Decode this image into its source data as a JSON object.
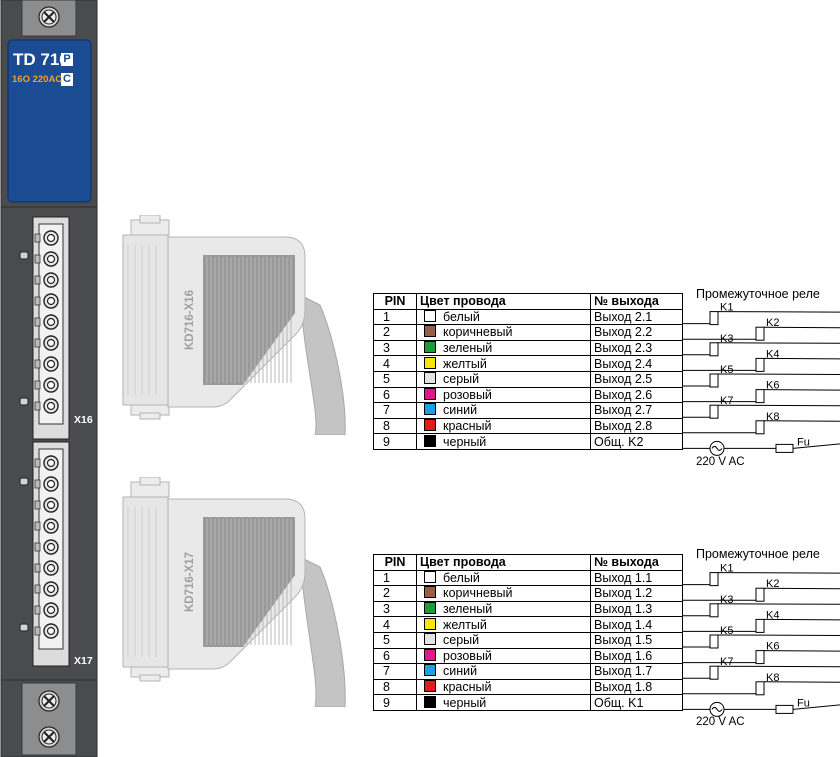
{
  "module": {
    "model": "TD 716",
    "badge_top": "P",
    "spec": "16O 220AC",
    "badge_bottom": "C",
    "connector_top_label": "X16",
    "connector_bottom_label": "X17"
  },
  "cables": [
    {
      "label": "KD716-X16"
    },
    {
      "label": "KD716-X17"
    }
  ],
  "colors": {
    "panel": "#4a4b4d",
    "label_plate": "#1b4c93",
    "spec_text": "#f0a030",
    "wire_colors": [
      "#ffffff",
      "#9a5d46",
      "#1f9a3a",
      "#f7e600",
      "#e4e4e4",
      "#e0188c",
      "#1ea0e0",
      "#e41b1b",
      "#000000"
    ]
  },
  "tables": [
    {
      "headers": [
        "PIN",
        "Цвет провода",
        "№ выхода"
      ],
      "relay_title": "Промежуточное реле",
      "ac_label": "220 V AC",
      "fuse_label": "Fu",
      "rows": [
        {
          "pin": "1",
          "color": "белый",
          "output": "Выход 2.1",
          "relay": "K1"
        },
        {
          "pin": "2",
          "color": "коричневый",
          "output": "Выход 2.2",
          "relay": "K2"
        },
        {
          "pin": "3",
          "color": "зеленый",
          "output": "Выход 2.3",
          "relay": "K3"
        },
        {
          "pin": "4",
          "color": "желтый",
          "output": "Выход 2.4",
          "relay": "K4"
        },
        {
          "pin": "5",
          "color": "серый",
          "output": "Выход 2.5",
          "relay": "K5"
        },
        {
          "pin": "6",
          "color": "розовый",
          "output": "Выход 2.6",
          "relay": "K6"
        },
        {
          "pin": "7",
          "color": "синий",
          "output": "Выход 2.7",
          "relay": "K7"
        },
        {
          "pin": "8",
          "color": "красный",
          "output": "Выход 2.8",
          "relay": "K8"
        },
        {
          "pin": "9",
          "color": "черный",
          "output": "Общ. K2",
          "relay": ""
        }
      ]
    },
    {
      "headers": [
        "PIN",
        "Цвет провода",
        "№ выхода"
      ],
      "relay_title": "Промежуточное реле",
      "ac_label": "220 V AC",
      "fuse_label": "Fu",
      "rows": [
        {
          "pin": "1",
          "color": "белый",
          "output": "Выход 1.1",
          "relay": "K1"
        },
        {
          "pin": "2",
          "color": "коричневый",
          "output": "Выход 1.2",
          "relay": "K2"
        },
        {
          "pin": "3",
          "color": "зеленый",
          "output": "Выход 1.3",
          "relay": "K3"
        },
        {
          "pin": "4",
          "color": "желтый",
          "output": "Выход 1.4",
          "relay": "K4"
        },
        {
          "pin": "5",
          "color": "серый",
          "output": "Выход 1.5",
          "relay": "K5"
        },
        {
          "pin": "6",
          "color": "розовый",
          "output": "Выход 1.6",
          "relay": "K6"
        },
        {
          "pin": "7",
          "color": "синий",
          "output": "Выход 1.7",
          "relay": "K7"
        },
        {
          "pin": "8",
          "color": "красный",
          "output": "Выход 1.8",
          "relay": "K8"
        },
        {
          "pin": "9",
          "color": "черный",
          "output": "Общ. K1",
          "relay": ""
        }
      ]
    }
  ]
}
